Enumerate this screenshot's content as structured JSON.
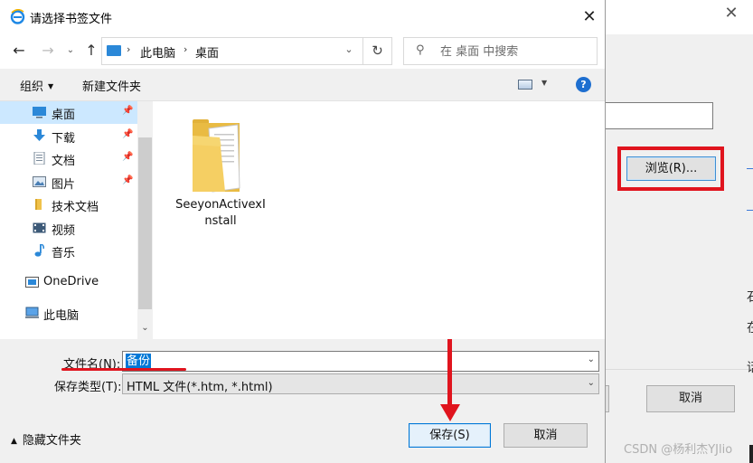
{
  "dialog": {
    "title": "请选择书签文件",
    "close_glyph": "✕"
  },
  "nav": {
    "back": "←",
    "forward": "→",
    "recent": "⌄",
    "up": "↑",
    "address": {
      "segments": [
        "此电脑",
        "桌面"
      ],
      "separator": "›"
    },
    "search_placeholder": "在 桌面 中搜索"
  },
  "toolbar": {
    "organize": "组织",
    "new_folder": "新建文件夹",
    "help": "?"
  },
  "sidebar": {
    "items": [
      {
        "label": "桌面",
        "icon": "desktop-icon",
        "pinned": true,
        "selected": true
      },
      {
        "label": "下载",
        "icon": "download-icon",
        "pinned": true,
        "selected": false
      },
      {
        "label": "文档",
        "icon": "document-icon",
        "pinned": true,
        "selected": false
      },
      {
        "label": "图片",
        "icon": "picture-icon",
        "pinned": true,
        "selected": false
      },
      {
        "label": "技术文档",
        "icon": "folder-icon",
        "pinned": false,
        "selected": false
      },
      {
        "label": "视频",
        "icon": "video-icon",
        "pinned": false,
        "selected": false
      },
      {
        "label": "音乐",
        "icon": "music-icon",
        "pinned": false,
        "selected": false
      },
      {
        "label": "OneDrive",
        "icon": "onedrive-icon",
        "pinned": false,
        "selected": false
      },
      {
        "label": "此电脑",
        "icon": "pc-icon",
        "pinned": false,
        "selected": false
      }
    ]
  },
  "content": {
    "files": [
      {
        "name": "SeeyonActivexInstall",
        "icon": "folder-icon"
      }
    ]
  },
  "fields": {
    "filename_label": "文件名(N):",
    "filename_value": "备份",
    "filetype_label": "保存类型(T):",
    "filetype_value": "HTML 文件(*.htm, *.html)"
  },
  "footer": {
    "hide_folders": "隐藏文件夹",
    "save": "保存(S)",
    "cancel": "取消"
  },
  "background_window": {
    "browse": "浏览(R)...",
    "cancel": "取消",
    "partial_button": ")"
  },
  "watermark": "CSDN @杨利杰YJlio",
  "colors": {
    "accent": "#0078d7",
    "annotation_red": "#e0141e",
    "selection": "#cce8ff"
  }
}
